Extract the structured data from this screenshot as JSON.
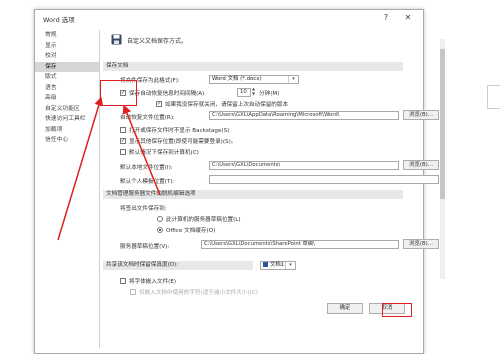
{
  "window": {
    "title": "Word 选项",
    "help_glyph": "?",
    "close_glyph": "✕"
  },
  "nav": {
    "items": [
      "常规",
      "显示",
      "校对",
      "保存",
      "版式",
      "语言",
      "高级",
      "自定义功能区",
      "快速访问工具栏",
      "加载项",
      "信任中心"
    ],
    "active_index": 3
  },
  "header_text": "自定义文档保存方式。",
  "save_docs": {
    "section_title": "保存文档",
    "format_label": "将文件保存为此格式(F):",
    "format_value": "Word 文档 (*.docx)",
    "autorecover_label": "保存自动恢复信息时间间隔(A)",
    "autorecover_minutes": "10",
    "minutes_label": "分钟(M)",
    "keep_last_label": "如果我没保存就关闭，请保留上次自动保留的版本",
    "autorecover_location_label": "自动恢复文件位置(R):",
    "autorecover_location_value": "C:\\Users\\GXL\\AppData\\Roaming\\Microsoft\\Word\\",
    "browse": "浏览(B)...",
    "backstage_label": "打开或保存文件时不显示 Backstage(S)",
    "show_more_label": "显示其他保存位置(即使可能需要登录)(S)。",
    "default_local_label": "默认情况下保存到计算机(C)",
    "default_local_location_label": "默认本地文件位置(I):",
    "default_local_location_value": "C:\\Users\\GXL\\Documents\\",
    "personal_templates_label": "默认个人模板位置(T):"
  },
  "offline": {
    "section_title": "文档管理服务器文件的脱机编辑选项",
    "save_to_label": "将签出文件保存到:",
    "opt_server_drafts": "此计算机的服务器草稿位置(L)",
    "opt_office_cache": "Office 文档缓存(O)",
    "server_drafts_label": "服务器草稿位置(V):",
    "server_drafts_value": "C:\\Users\\GXL\\Documents\\SharePoint 草稿\\",
    "browse": "浏览(B)..."
  },
  "fidelity": {
    "section_title": "共享该文档时保留保真度(D):",
    "document_value": "文档1",
    "embed_fonts_label": "将字体嵌入文件(E)",
    "embed_chars_label": "仅嵌入文档中使用的字符(适于减小文件大小)(C)"
  },
  "footer": {
    "ok": "确定",
    "cancel": "取消"
  },
  "colors": {
    "accent": "#e02020",
    "section_bg": "#e8e8e8",
    "active_nav": "#d6d6d6"
  }
}
